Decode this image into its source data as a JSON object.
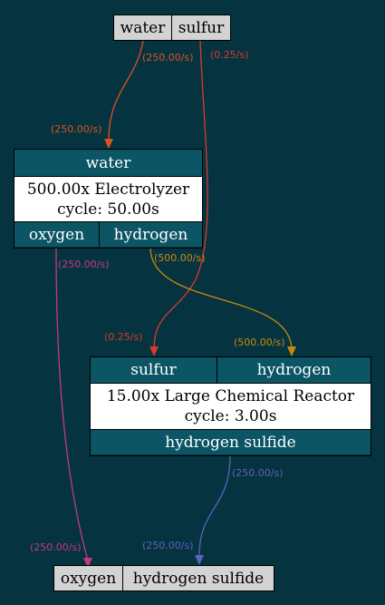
{
  "colors": {
    "background": "#063340",
    "port_fill": "#0b5564",
    "io_fill": "#d3d3d3",
    "water_edge": "#d9541e",
    "sulfur_edge": "#d93a2b",
    "oxygen_edge": "#c43a7e",
    "hydrogen_edge": "#c98a0c",
    "h2s_edge": "#5b63bd"
  },
  "inputs": {
    "water": "water",
    "sulfur": "sulfur"
  },
  "electrolyzer": {
    "input_water": "water",
    "title": "500.00x Electrolyzer",
    "cycle": "cycle: 50.00s",
    "output_oxygen": "oxygen",
    "output_hydrogen": "hydrogen"
  },
  "reactor": {
    "input_sulfur": "sulfur",
    "input_hydrogen": "hydrogen",
    "title": "15.00x Large Chemical Reactor",
    "cycle": "cycle: 3.00s",
    "output_h2s": "hydrogen sulfide"
  },
  "outputs": {
    "oxygen": "oxygen",
    "h2s": "hydrogen sulfide"
  },
  "edge_labels": {
    "water_out": "(250.00/s)",
    "water_in": "(250.00/s)",
    "sulfur_out": "(0.25/s)",
    "sulfur_in": "(0.25/s)",
    "oxygen_out": "(250.00/s)",
    "oxygen_in": "(250.00/s)",
    "hydrogen_out": "(500.00/s)",
    "hydrogen_in": "(500.00/s)",
    "h2s_out": "(250.00/s)",
    "h2s_in": "(250.00/s)"
  }
}
